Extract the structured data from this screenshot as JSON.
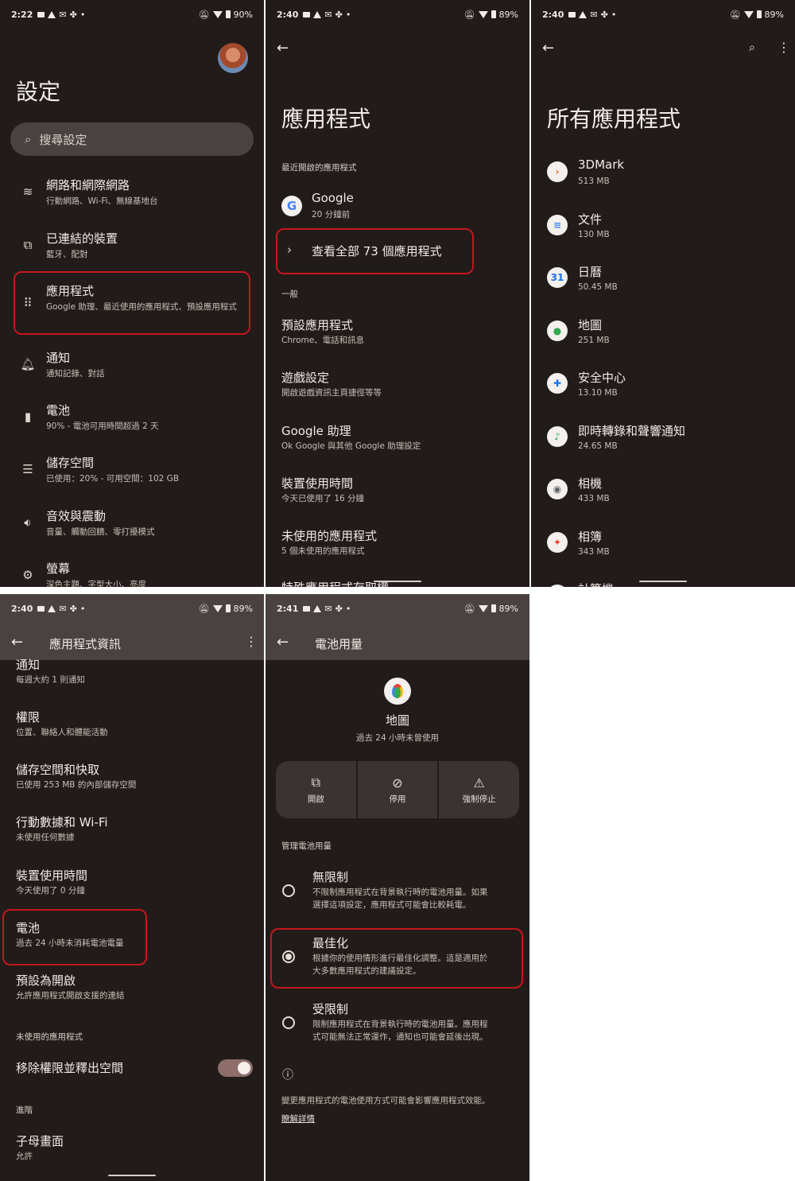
{
  "colors": {
    "background": "#211c1a",
    "surface": "#4a4240",
    "highlight": "#c4161c",
    "text": "#f1ebe7"
  },
  "p1": {
    "status": {
      "time": "2:22",
      "battery": "90%"
    },
    "title": "設定",
    "search_placeholder": "搜尋設定",
    "items": [
      {
        "title": "網路和網際網路",
        "sub": "行動網路、Wi-Fi、無線基地台",
        "icon": "wifi-icon"
      },
      {
        "title": "已連結的裝置",
        "sub": "藍牙、配對",
        "icon": "devices-icon"
      },
      {
        "title": "應用程式",
        "sub": "Google 助理、最近使用的應用程式、預設應用程式",
        "icon": "apps-grid-icon"
      },
      {
        "title": "通知",
        "sub": "通知記錄、對話",
        "icon": "bell-icon"
      },
      {
        "title": "電池",
        "sub": "90% - 電池可用時間超過 2 天",
        "icon": "battery-icon"
      },
      {
        "title": "儲存空間",
        "sub": "已使用：20% - 可用空間：102 GB",
        "icon": "storage-icon"
      },
      {
        "title": "音效與震動",
        "sub": "音量、觸動回饋、零打擾模式",
        "icon": "volume-icon"
      },
      {
        "title": "螢幕",
        "sub": "深色主題、字型大小、亮度",
        "icon": "display-icon"
      }
    ]
  },
  "p2": {
    "status": {
      "time": "2:40",
      "battery": "89%"
    },
    "title": "應用程式",
    "recent_header": "最近開啟的應用程式",
    "recent_app": {
      "name": "Google",
      "sub": "20 分鐘前"
    },
    "see_all": "查看全部 73 個應用程式",
    "general_header": "一般",
    "items": [
      {
        "title": "預設應用程式",
        "sub": "Chrome、電話和訊息"
      },
      {
        "title": "遊戲設定",
        "sub": "開啟遊戲資訊主頁捷徑等等"
      },
      {
        "title": "Google 助理",
        "sub": "Ok Google 與其他 Google 助理設定"
      },
      {
        "title": "裝置使用時間",
        "sub": "今天已使用了 16 分鐘"
      },
      {
        "title": "未使用的應用程式",
        "sub": "5 個未使用的應用程式"
      },
      {
        "title": "特殊應用程式存取權",
        "sub": ""
      }
    ]
  },
  "p3": {
    "status": {
      "time": "2:40",
      "battery": "89%"
    },
    "title": "所有應用程式",
    "apps": [
      {
        "name": "3DMark",
        "size": "513 MB",
        "color": "#e8701a",
        "glyph": "›"
      },
      {
        "name": "文件",
        "size": "130 MB",
        "color": "#4285f4",
        "glyph": "≡"
      },
      {
        "name": "日曆",
        "size": "50.45 MB",
        "color": "#1a73e8",
        "glyph": "31"
      },
      {
        "name": "地圖",
        "size": "251 MB",
        "color": "#34a853",
        "glyph": "●"
      },
      {
        "name": "安全中心",
        "size": "13.10 MB",
        "color": "#1a73e8",
        "glyph": "✚"
      },
      {
        "name": "即時轉錄和聲響通知",
        "size": "24.65 MB",
        "color": "#34a853",
        "glyph": "♪"
      },
      {
        "name": "相機",
        "size": "433 MB",
        "color": "#5f6368",
        "glyph": "◉"
      },
      {
        "name": "相簿",
        "size": "343 MB",
        "color": "#ea4335",
        "glyph": "✦"
      },
      {
        "name": "計算機",
        "size": "",
        "color": "#4285f4",
        "glyph": "="
      }
    ]
  },
  "p4": {
    "status": {
      "time": "2:40",
      "battery": "89%"
    },
    "appbar_title": "應用程式資訊",
    "items": [
      {
        "title": "通知",
        "sub": "每週大約 1 則通知"
      },
      {
        "title": "權限",
        "sub": "位置、聯絡人和體能活動"
      },
      {
        "title": "儲存空間和快取",
        "sub": "已使用 253 MB 的內部儲存空間"
      },
      {
        "title": "行動數據和 Wi-Fi",
        "sub": "未使用任何數據"
      },
      {
        "title": "裝置使用時間",
        "sub": "今天使用了 0 分鐘"
      },
      {
        "title": "電池",
        "sub": "過去 24 小時未消耗電池電量"
      },
      {
        "title": "預設為開啟",
        "sub": "允許應用程式開啟支援的連結"
      }
    ],
    "unused_header": "未使用的應用程式",
    "remove_perm": "移除權限並釋出空間",
    "advanced_header": "進階",
    "pip": {
      "title": "子母畫面",
      "sub": "允許"
    }
  },
  "p5": {
    "status": {
      "time": "2:41",
      "battery": "89%"
    },
    "appbar_title": "電池用量",
    "app_name": "地圖",
    "app_sub": "過去 24 小時未曾使用",
    "actions": [
      {
        "label": "開啟",
        "icon": "open-external-icon"
      },
      {
        "label": "停用",
        "icon": "disable-icon"
      },
      {
        "label": "強制停止",
        "icon": "warning-icon"
      }
    ],
    "manage_header": "管理電池用量",
    "options": [
      {
        "title": "無限制",
        "sub1": "不限制應用程式在背景執行時的電池用量。如果",
        "sub2": "選擇這項設定，應用程式可能會比較耗電。",
        "selected": false
      },
      {
        "title": "最佳化",
        "sub1": "根據你的使用情形進行最佳化調整。這是適用於",
        "sub2": "大多數應用程式的建議設定。",
        "selected": true
      },
      {
        "title": "受限制",
        "sub1": "限制應用程式在背景執行時的電池用量。應用程",
        "sub2": "式可能無法正常運作，通知也可能會延後出現。",
        "selected": false
      }
    ],
    "footer_text": "變更應用程式的電池使用方式可能會影響應用程式效能。",
    "learn_more": "瞭解詳情"
  }
}
